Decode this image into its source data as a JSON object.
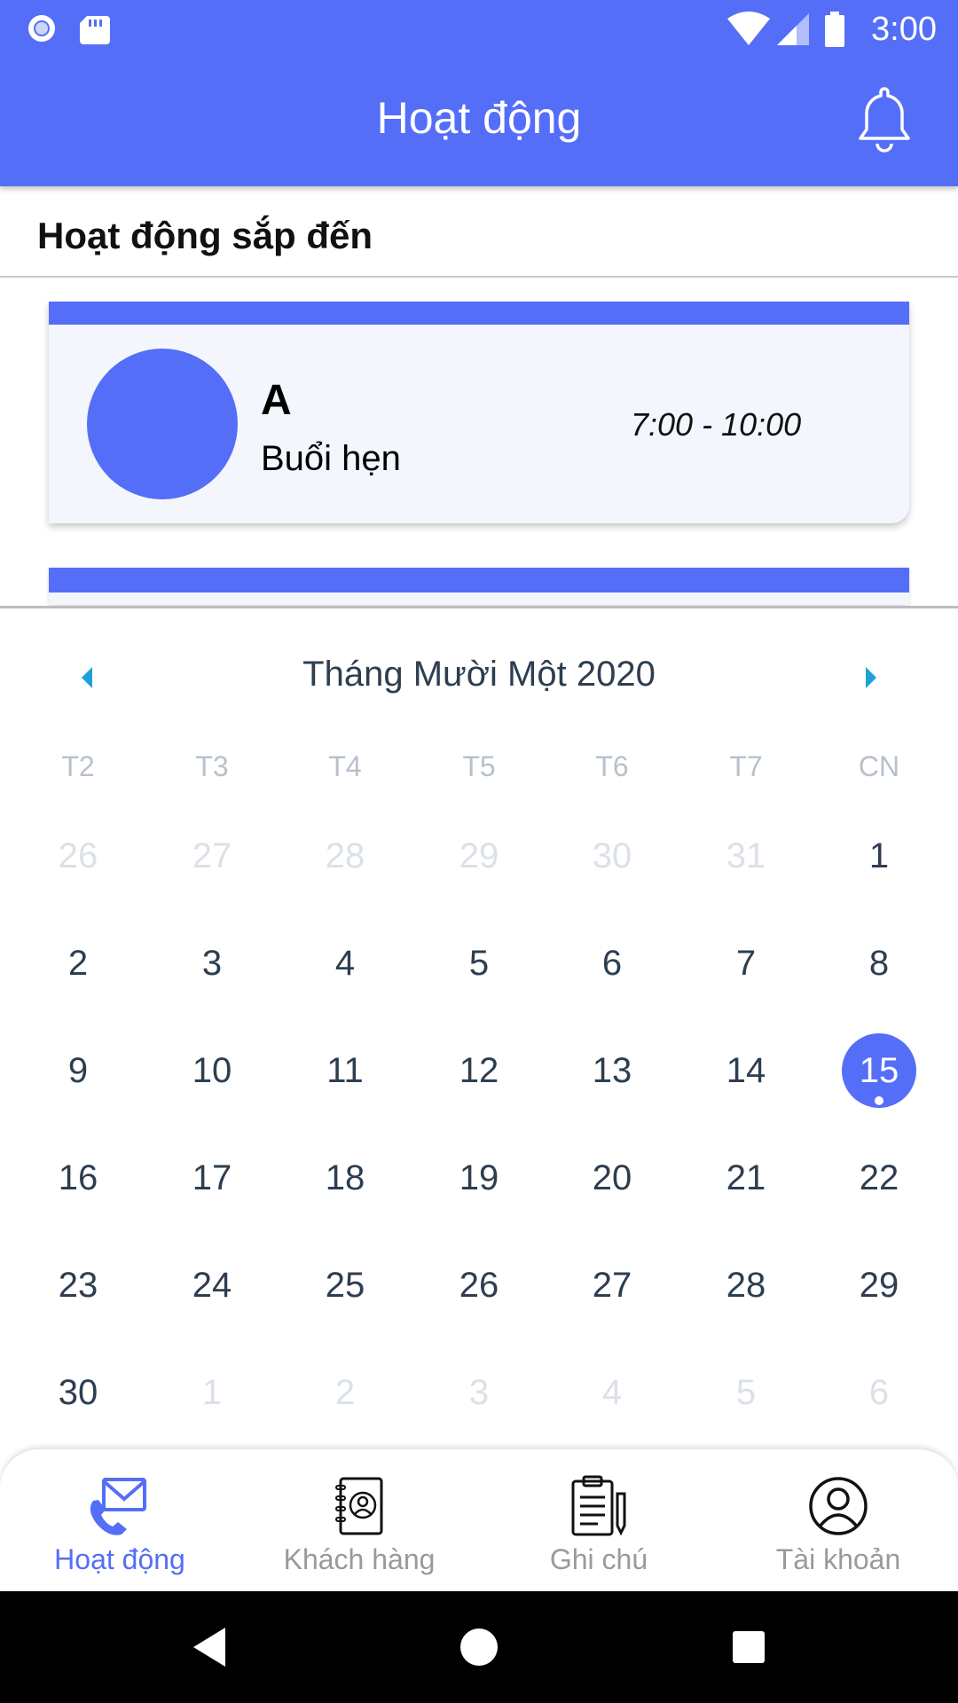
{
  "status_bar": {
    "time": "3:00",
    "icons": [
      "notification-dot-icon",
      "sd-card-icon",
      "wifi-icon",
      "signal-icon",
      "battery-icon"
    ]
  },
  "app_bar": {
    "title": "Hoạt động",
    "action_icon": "bell-icon"
  },
  "upcoming": {
    "title": "Hoạt động sắp đến",
    "cards": [
      {
        "name": "A",
        "type": "Buổi hẹn",
        "time": "7:00 - 10:00"
      }
    ]
  },
  "calendar": {
    "month_label": "Tháng Mười Một 2020",
    "weekdays": [
      "T2",
      "T3",
      "T4",
      "T5",
      "T6",
      "T7",
      "CN"
    ],
    "weeks": [
      [
        "26",
        "27",
        "28",
        "29",
        "30",
        "31",
        "1"
      ],
      [
        "2",
        "3",
        "4",
        "5",
        "6",
        "7",
        "8"
      ],
      [
        "9",
        "10",
        "11",
        "12",
        "13",
        "14",
        "15"
      ],
      [
        "16",
        "17",
        "18",
        "19",
        "20",
        "21",
        "22"
      ],
      [
        "23",
        "24",
        "25",
        "26",
        "27",
        "28",
        "29"
      ],
      [
        "30",
        "1",
        "2",
        "3",
        "4",
        "5",
        "6"
      ]
    ],
    "selected_day": "15"
  },
  "bottom_nav": {
    "items": [
      {
        "label": "Hoạt động",
        "icon": "phone-mail-icon",
        "active": true
      },
      {
        "label": "Khách hàng",
        "icon": "contact-book-icon",
        "active": false
      },
      {
        "label": "Ghi chú",
        "icon": "clipboard-icon",
        "active": false
      },
      {
        "label": "Tài khoản",
        "icon": "user-circle-icon",
        "active": false
      }
    ]
  },
  "colors": {
    "primary": "#556ef8",
    "text_dark": "#2d3e50",
    "muted_day": "#dbe1e8",
    "weekday": "#b7c1cc",
    "arrow": "#1aa3d9"
  }
}
